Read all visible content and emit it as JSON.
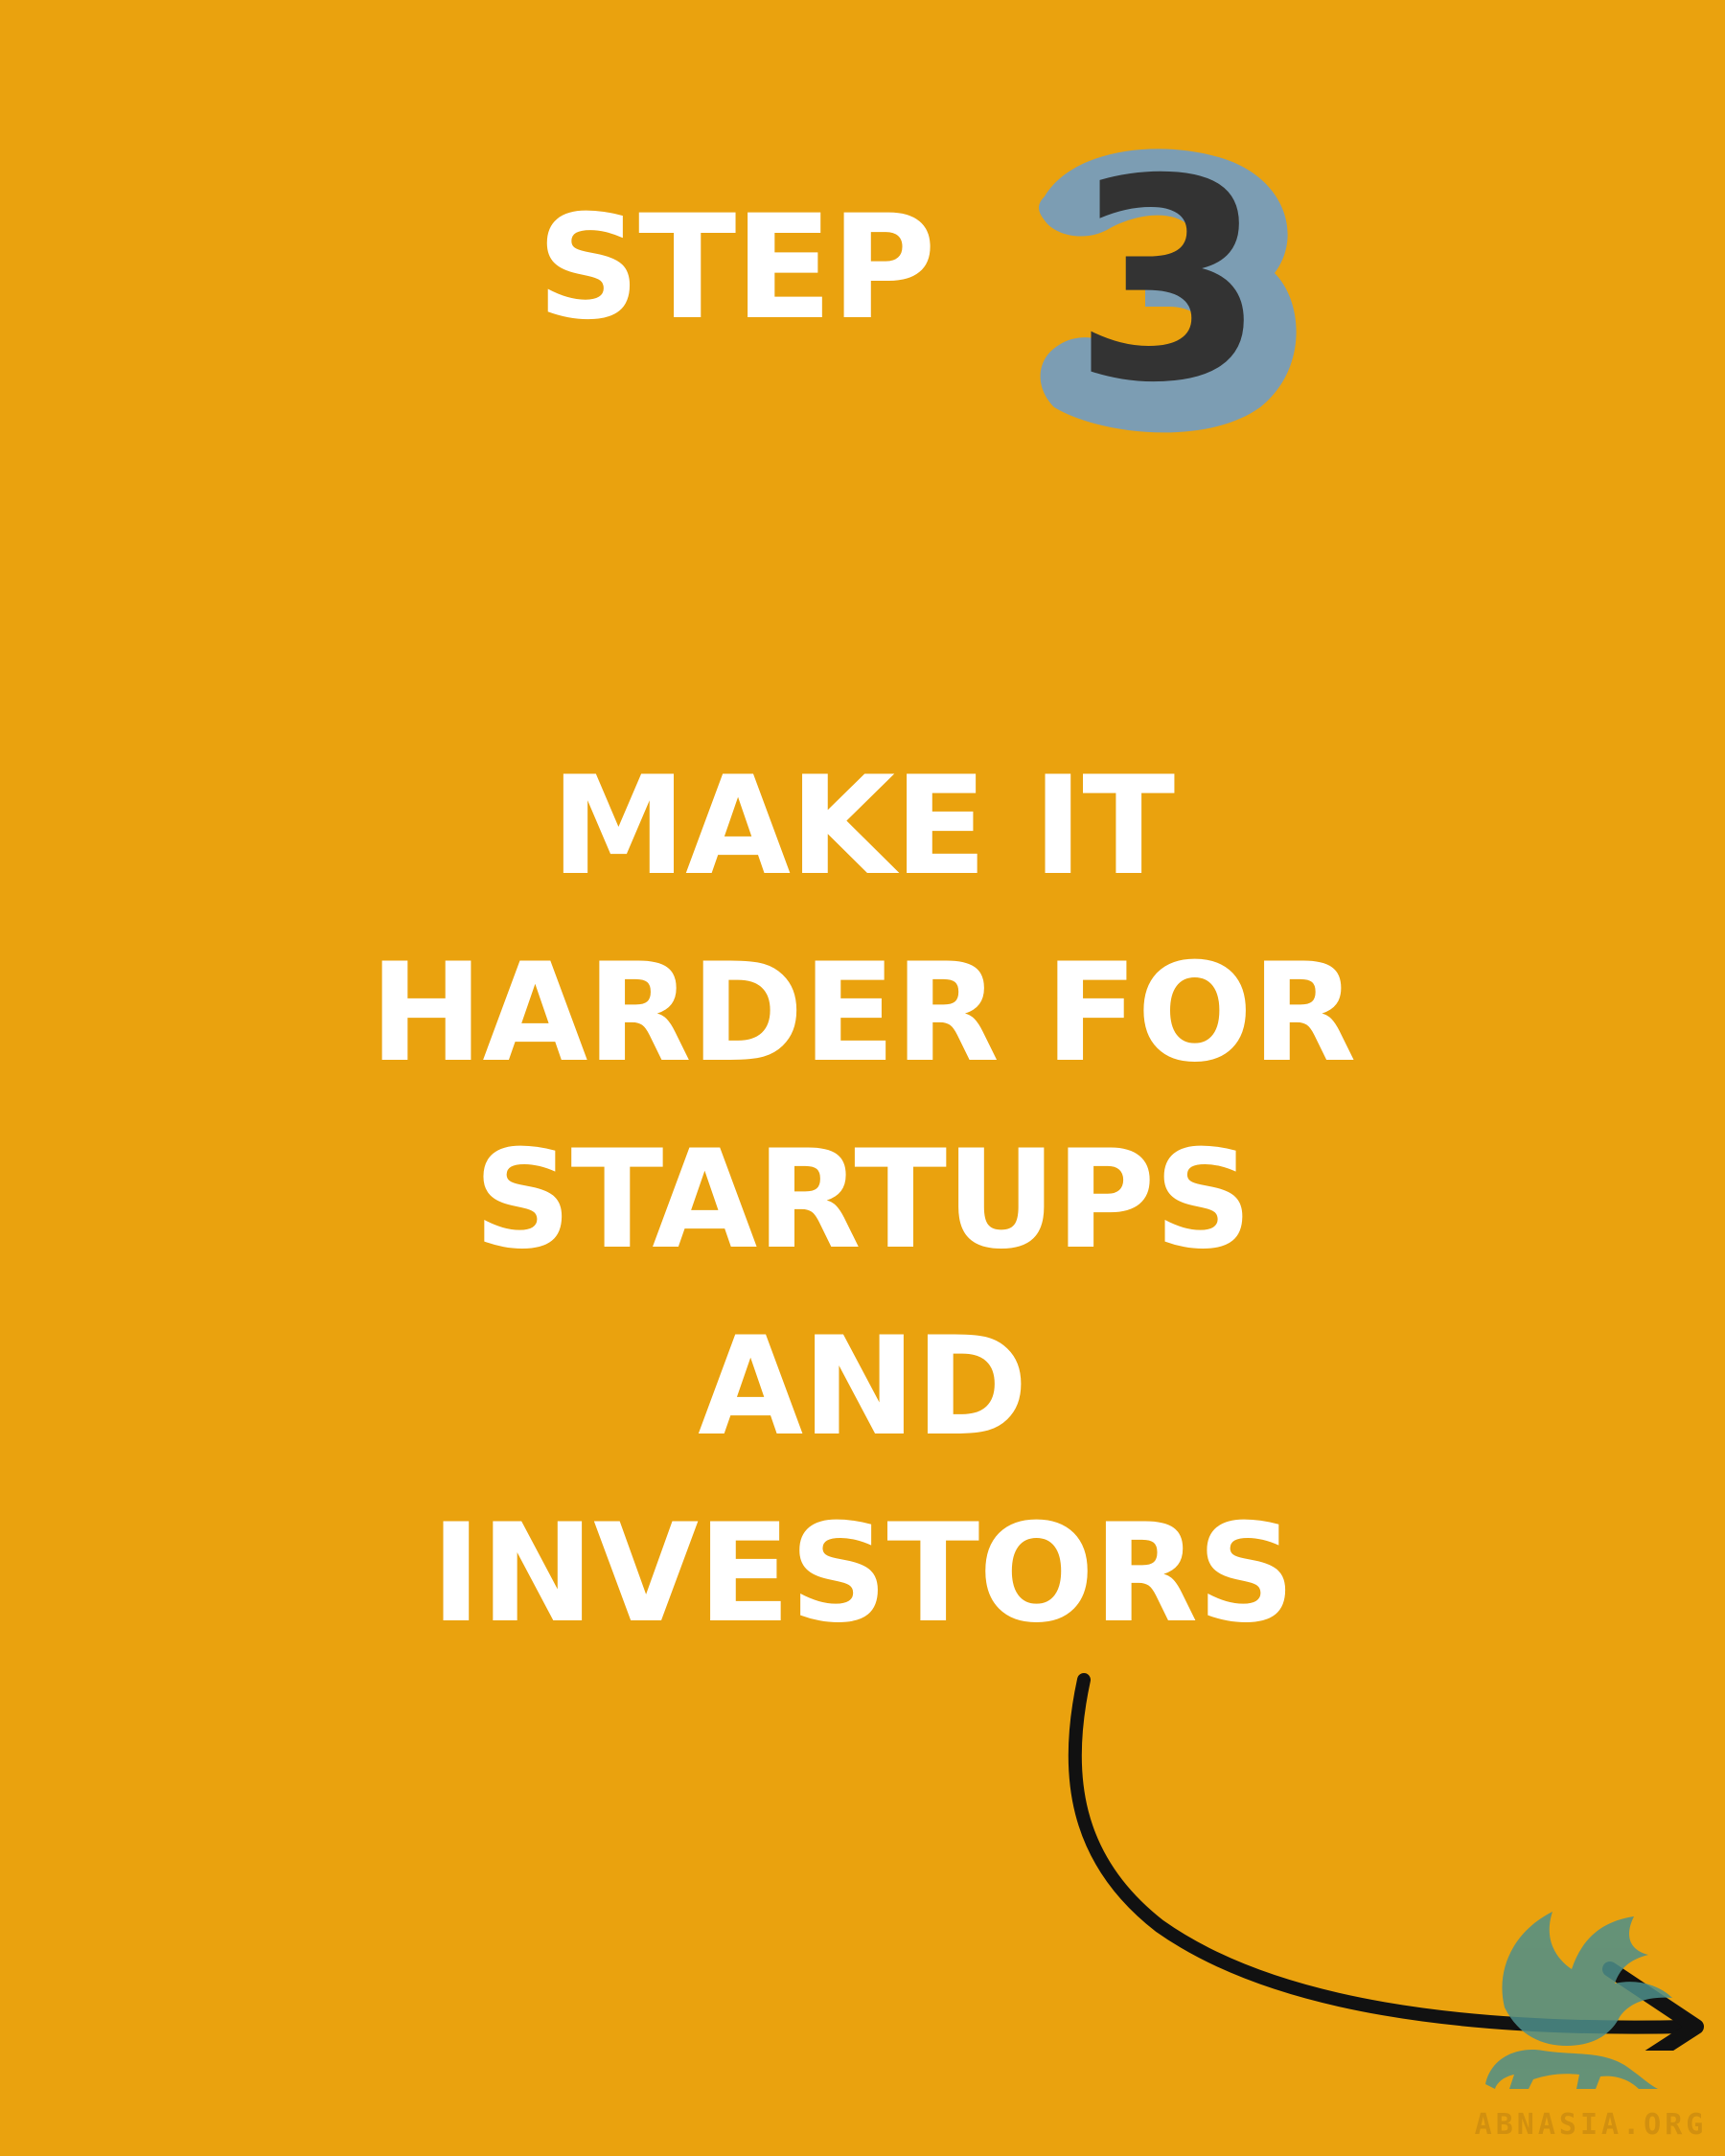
{
  "step": {
    "word": "STEP",
    "number": "3"
  },
  "headline": {
    "lines": [
      "MAKE IT",
      "HARDER FOR",
      "STARTUPS",
      "AND",
      "INVESTORS"
    ]
  },
  "watermark": {
    "text": "ABNASIA.ORG",
    "icon": "winged-lion-logo-icon"
  },
  "colors": {
    "background": "#EAA20E",
    "text": "#FFFFFF",
    "number_fill": "#333333",
    "number_outline": "#7C9DB3",
    "arrow": "#111111",
    "logo": "#4E8F8A"
  }
}
